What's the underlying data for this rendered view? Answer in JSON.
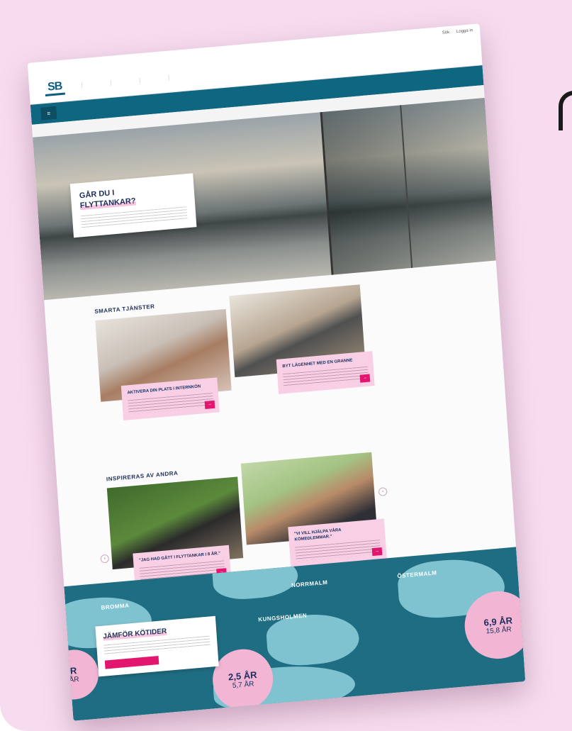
{
  "topbar": {
    "search_label": "Sök",
    "login_label": "Logga in"
  },
  "logo": {
    "text": "SB"
  },
  "nav": {
    "items": [
      "",
      "",
      "",
      ""
    ]
  },
  "notice": {
    "menu_icon": "menu-icon"
  },
  "breadcrumb": "",
  "hero": {
    "title_line1": "GÅR DU I",
    "title_line2": "FLYTTANKAR?"
  },
  "smart_services": {
    "title": "SMARTA TJÄNSTER",
    "cards": [
      {
        "title": "AKTIVERA DIN PLATS I INTERNKÖN"
      },
      {
        "title": "BYT LÄGENHET MED EN GRANNE"
      }
    ]
  },
  "inspire": {
    "title": "INSPIRERAS AV ANDRA",
    "cards": [
      {
        "title": "\"JAG HAD GÅTT I FLYTTANKAR I 8 ÅR.\""
      },
      {
        "title": "\"VI VILL HJÄLPA VÅRA KÖMEDLEMMAR.\""
      }
    ]
  },
  "map": {
    "districts": [
      "BROMMA",
      "KUNGSHOLMEN",
      "NORRMALM",
      "ÖSTERMALM"
    ],
    "bubbles": [
      {
        "primary": "R",
        "secondary": "ÅR"
      },
      {
        "primary": "2,5 ÅR",
        "secondary": "5,7 ÅR"
      },
      {
        "primary": "6,9 ÅR",
        "secondary": "15,8 ÅR"
      }
    ],
    "compare": {
      "title": "JÄMFÖR KÖTIDER",
      "button": ""
    }
  },
  "colors": {
    "background": "#f7dcef",
    "accent": "#e3166f",
    "navy": "#1b2d5c",
    "teal": "#0f6680",
    "map_water": "#1f6d82",
    "map_land": "#7fc3d1"
  }
}
